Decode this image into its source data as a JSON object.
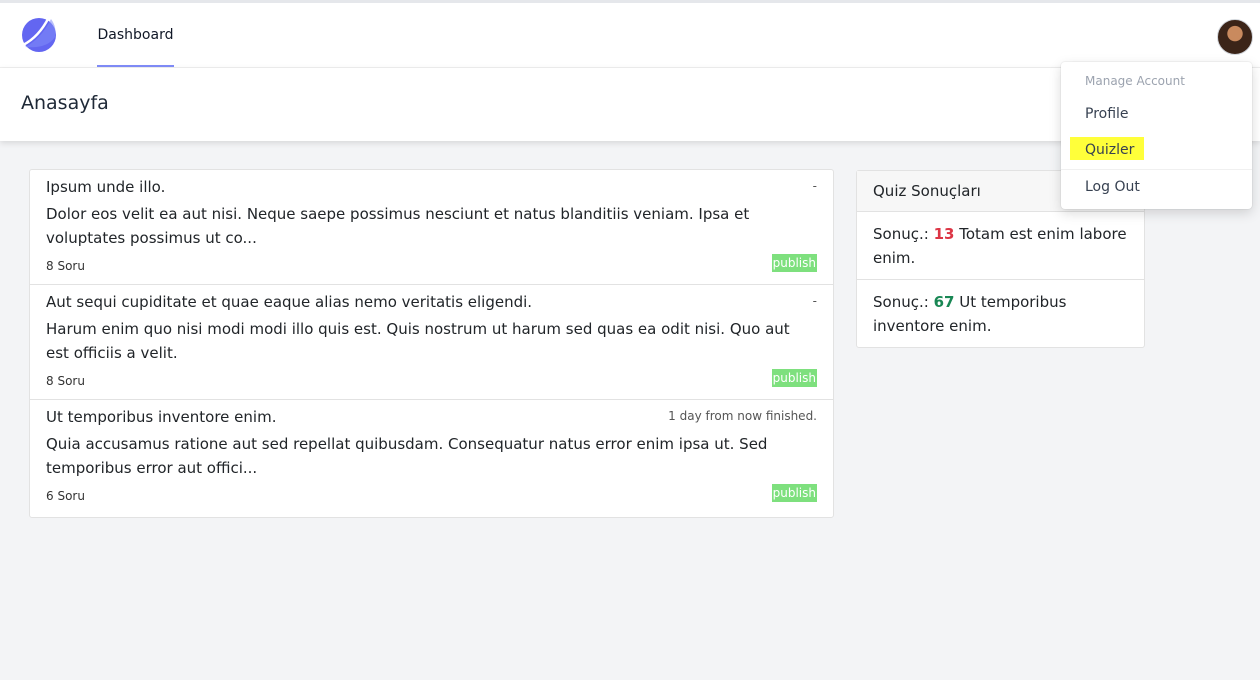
{
  "nav": {
    "dashboard_label": "Dashboard"
  },
  "header": {
    "title": "Anasayfa"
  },
  "quizzes": [
    {
      "title": "Ipsum unde illo.",
      "meta": "-",
      "description": "Dolor eos velit ea aut nisi. Neque saepe possimus nesciunt et natus blanditiis veniam. Ipsa et voluptates possimus ut co...",
      "count": "8 Soru",
      "status": "publish"
    },
    {
      "title": "Aut sequi cupiditate et quae eaque alias nemo veritatis eligendi.",
      "meta": "-",
      "description": "Harum enim quo nisi modi modi illo quis est. Quis nostrum ut harum sed quas ea odit nisi. Quo aut est officiis a velit.",
      "count": "8 Soru",
      "status": "publish"
    },
    {
      "title": "Ut temporibus inventore enim.",
      "meta": "1 day from now finished.",
      "description": "Quia accusamus ratione aut sed repellat quibusdam. Consequatur natus error enim ipsa ut. Sed temporibus error aut offici...",
      "count": "6 Soru",
      "status": "publish"
    }
  ],
  "results": {
    "title": "Quiz Sonuçları",
    "items": [
      {
        "label": "Sonuç.:",
        "score": "13",
        "quiz": "Totam est enim labore enim."
      },
      {
        "label": "Sonuç.:",
        "score": "67",
        "quiz": "Ut temporibus inventore enim."
      }
    ]
  },
  "dropdown": {
    "title": "Manage Account",
    "profile": "Profile",
    "quizler": "Quizler",
    "logout": "Log Out"
  },
  "colors": {
    "accent": "#818cf8",
    "badge": "#7ee07e",
    "score_low": "#dc3545",
    "score_high": "#198754",
    "highlight": "#ffff3a"
  }
}
